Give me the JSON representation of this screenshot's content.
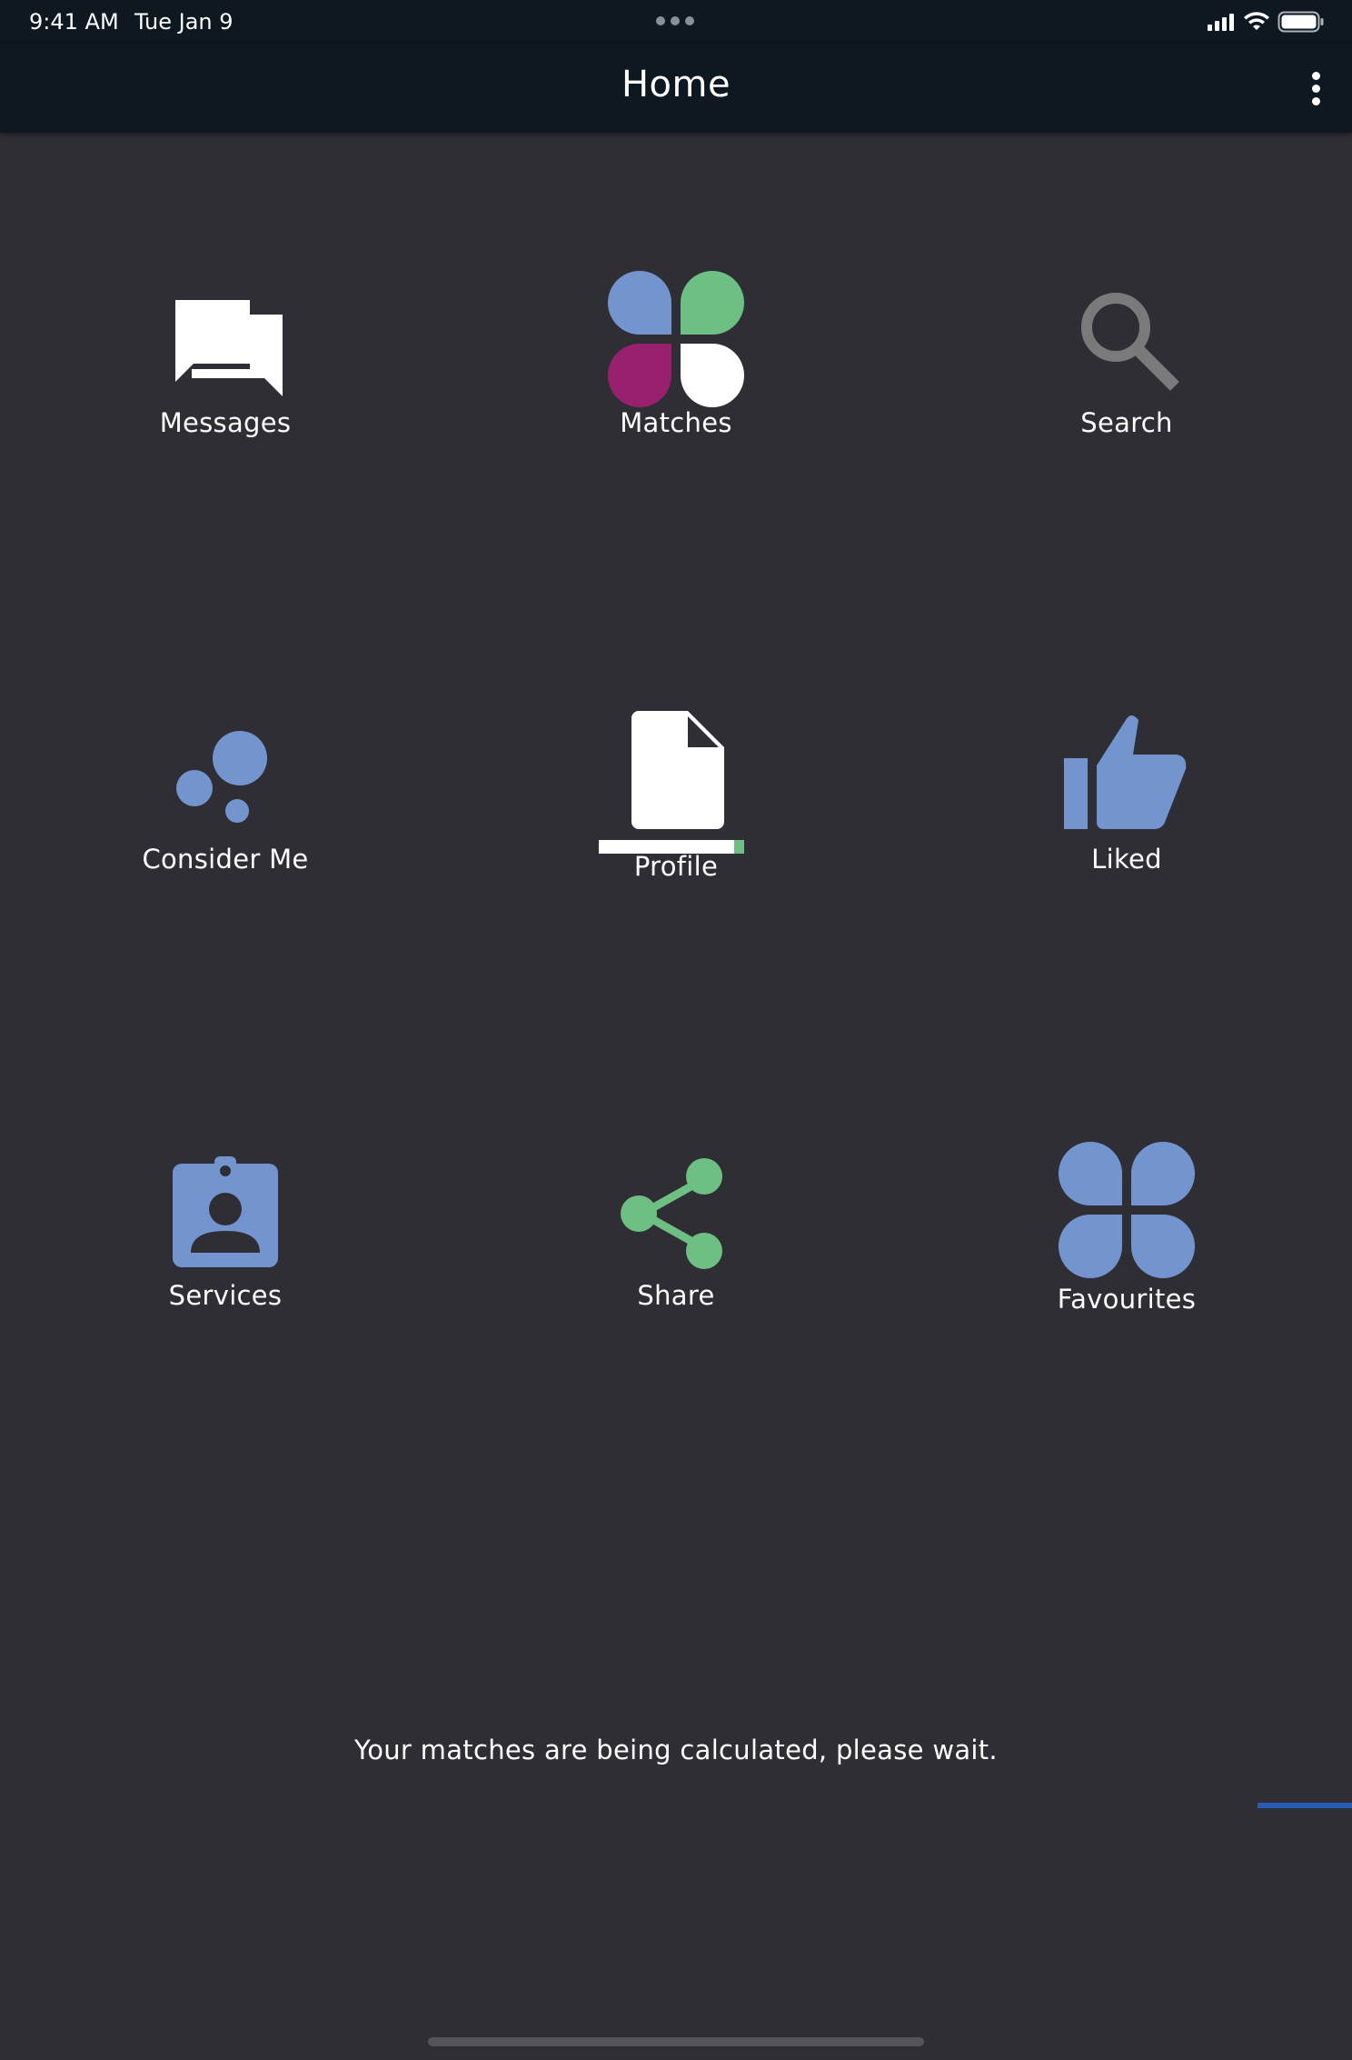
{
  "status_bar": {
    "time": "9:41 AM",
    "date": "Tue Jan 9"
  },
  "nav": {
    "title": "Home",
    "more_icon": "more-vertical-icon"
  },
  "tiles": [
    {
      "label": "Messages",
      "icon": "chat-bubbles-icon",
      "color": "#ffffff"
    },
    {
      "label": "Matches",
      "icon": "clover-petals-icon",
      "colors": [
        "#7494d0",
        "#6dbf83",
        "#98206e",
        "#ffffff"
      ]
    },
    {
      "label": "Search",
      "icon": "search-icon",
      "color": "#7a7a7a"
    },
    {
      "label": "Consider Me",
      "icon": "bubbles-icon",
      "color": "#7494d0"
    },
    {
      "label": "Profile",
      "icon": "document-icon",
      "color": "#ffffff",
      "completion": 0.93
    },
    {
      "label": "Liked",
      "icon": "thumbs-up-icon",
      "color": "#7494d0"
    },
    {
      "label": "Services",
      "icon": "id-badge-icon",
      "color": "#7494d0"
    },
    {
      "label": "Share",
      "icon": "share-icon",
      "color": "#6dbf83"
    },
    {
      "label": "Favourites",
      "icon": "four-petal-icon",
      "color": "#7494d0"
    }
  ],
  "message": "Your matches are being calculated, please wait."
}
